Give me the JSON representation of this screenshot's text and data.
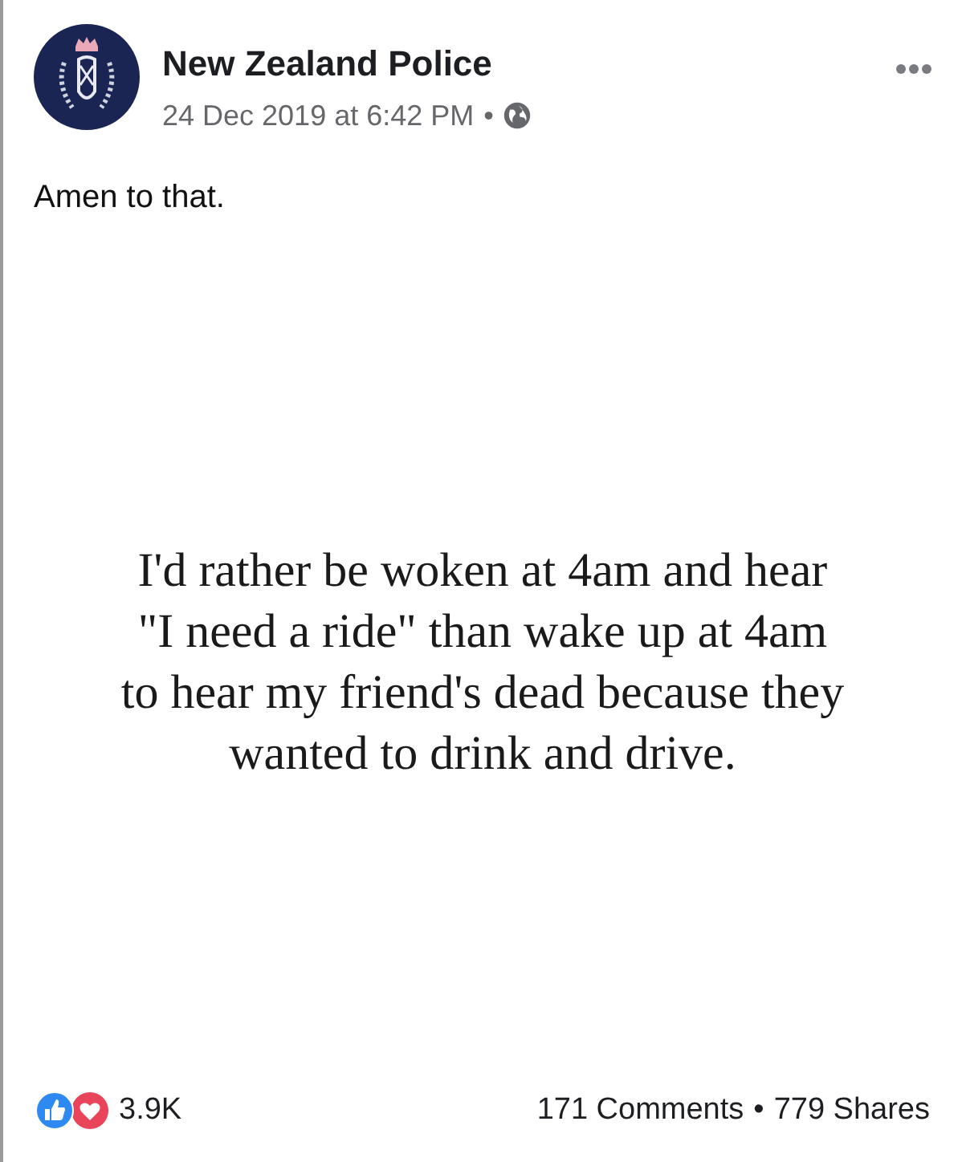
{
  "post": {
    "author": "New Zealand Police",
    "timestamp": "24 Dec 2019 at 6:42 PM",
    "timestamp_separator": "•",
    "text": "Amen to that."
  },
  "image_card": {
    "quote_lines": [
      "I'd rather be woken at 4am and hear",
      "\"I need a ride\" than wake up at 4am",
      "to hear my friend's dead because they",
      "wanted to drink and drive."
    ]
  },
  "footer": {
    "reactions_count": "3.9K",
    "comments": "171 Comments",
    "separator": "•",
    "shares": "779 Shares"
  }
}
